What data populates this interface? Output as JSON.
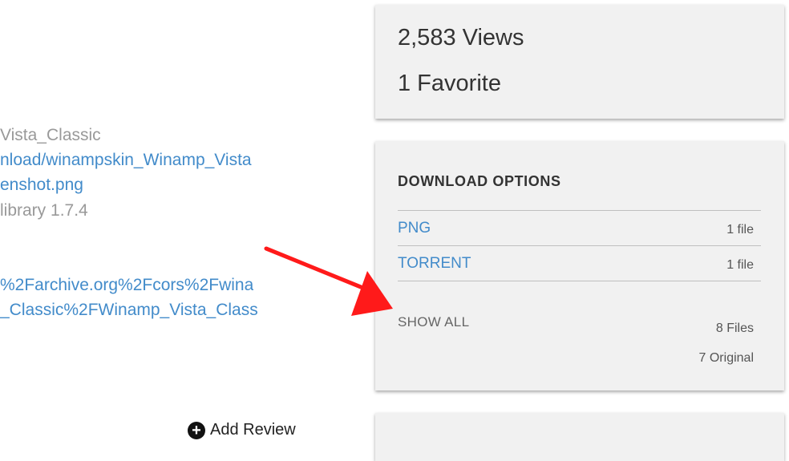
{
  "metadata": {
    "lines": [
      {
        "text": "Vista_Classic",
        "kind": "gray"
      },
      {
        "text": "nload/winampskin_Winamp_Vista",
        "kind": "link"
      },
      {
        "text": "enshot.png",
        "kind": "link"
      },
      {
        "text": " library 1.7.4",
        "kind": "gray"
      },
      {
        "text": "%2Farchive.org%2Fcors%2Fwina",
        "kind": "link"
      },
      {
        "text": "_Classic%2FWinamp_Vista_Class",
        "kind": "link"
      }
    ]
  },
  "stats": {
    "views": "2,583 Views",
    "favorites": "1 Favorite"
  },
  "download_options": {
    "title": "DOWNLOAD OPTIONS",
    "rows": [
      {
        "label": "PNG",
        "count": "1 file"
      },
      {
        "label": "TORRENT",
        "count": "1 file"
      }
    ],
    "show_all": "SHOW ALL",
    "total_files": "8 Files",
    "original_files": "7 Original"
  },
  "add_review": {
    "label": "Add Review",
    "icon": "plus-circle-icon"
  },
  "colors": {
    "link": "#428bca",
    "card": "#f1f1f1",
    "arrow": "#ff1a1a"
  }
}
